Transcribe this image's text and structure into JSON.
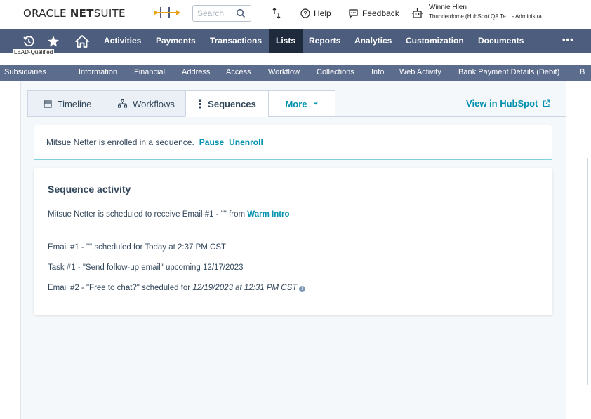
{
  "topbar": {
    "logo_main": "ORACLE ",
    "logo_bold": "NET",
    "logo_rest": "SUITE",
    "search_placeholder": "Search",
    "help_label": "Help",
    "feedback_label": "Feedback",
    "user_name": "Winnie Hien",
    "user_context": "Thunderdome (HubSpot QA Te...  - Administra..."
  },
  "record_status": "LEAD-Qualified",
  "main_nav": {
    "items": [
      "Activities",
      "Payments",
      "Transactions",
      "Lists",
      "Reports",
      "Analytics",
      "Customization",
      "Documents"
    ],
    "active": "Lists",
    "more_label": "•••"
  },
  "sub_nav": {
    "items": [
      "Subsidiaries",
      "Information",
      "Financial",
      "Address",
      "Access",
      "Workflow",
      "Collections",
      "Info",
      "Web Activity",
      "Bank Payment Details (Debit)",
      "B"
    ]
  },
  "tabs": {
    "items": [
      "Timeline",
      "Workflows",
      "Sequences",
      "More"
    ],
    "active": "Sequences",
    "view_link": "View in HubSpot"
  },
  "enrollment_alert": {
    "message": "Mitsue Netter is enrolled in a sequence.",
    "pause_label": "Pause",
    "unenroll_label": "Unenroll"
  },
  "sequence_activity": {
    "title": "Sequence activity",
    "schedule_prefix": "Mitsue Netter is scheduled to receive Email #1 - \"\" from ",
    "sequence_name": "Warm Intro",
    "steps": [
      "Email #1 - \"\" scheduled for Today at 2:37 PM CST",
      "Task #1 - \"Send follow-up email\" upcoming 12/17/2023"
    ],
    "step3_prefix": "Email #2 - \"Free to chat?\" scheduled for ",
    "step3_date": "12/19/2023 at 12:31 PM CST"
  },
  "colors": {
    "nav_bg": "#4d5d7d",
    "subnav_bg": "#5b6c8d",
    "link": "#0091ae",
    "text": "#33475b"
  }
}
